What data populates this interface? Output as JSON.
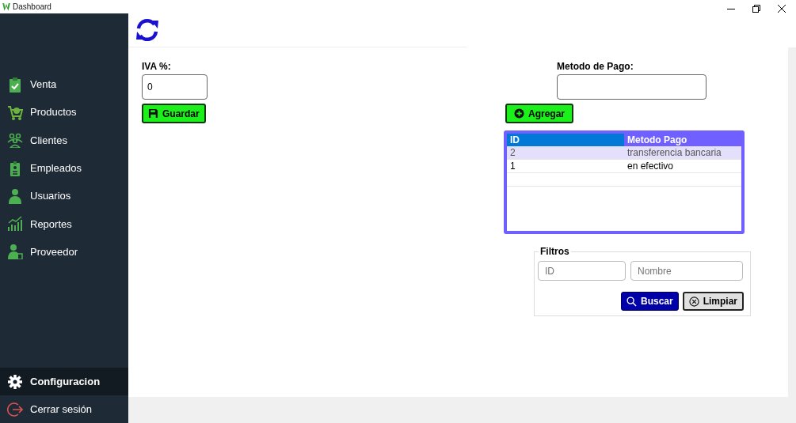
{
  "window": {
    "title": "Dashboard"
  },
  "sidebar": {
    "items": [
      {
        "label": "Venta",
        "selected": false
      },
      {
        "label": "Productos",
        "selected": false
      },
      {
        "label": "Clientes",
        "selected": false
      },
      {
        "label": "Empleados",
        "selected": false
      },
      {
        "label": "Usuarios",
        "selected": false
      },
      {
        "label": "Reportes",
        "selected": false
      },
      {
        "label": "Proveedor",
        "selected": false
      }
    ],
    "bottom_items": [
      {
        "label": "Configuracion",
        "selected": true
      },
      {
        "label": "Cerrar sesión",
        "selected": false
      }
    ]
  },
  "iva": {
    "label": "IVA %:",
    "value": "0",
    "button": "Guardar"
  },
  "payment": {
    "label": "Metodo de Pago:",
    "button": "Agregar"
  },
  "table": {
    "columns": [
      "ID",
      "Metodo Pago"
    ],
    "rows": [
      {
        "cells": [
          "2",
          "transferencia bancaria"
        ],
        "selected": true
      },
      {
        "cells": [
          "1",
          "en efectivo"
        ],
        "selected": false
      }
    ]
  },
  "filters": {
    "title": "Filtros",
    "fields": [
      {
        "placeholder": "ID"
      },
      {
        "placeholder": "Nombre"
      }
    ],
    "search_button": "Buscar",
    "clear_button": "Limpiar"
  }
}
